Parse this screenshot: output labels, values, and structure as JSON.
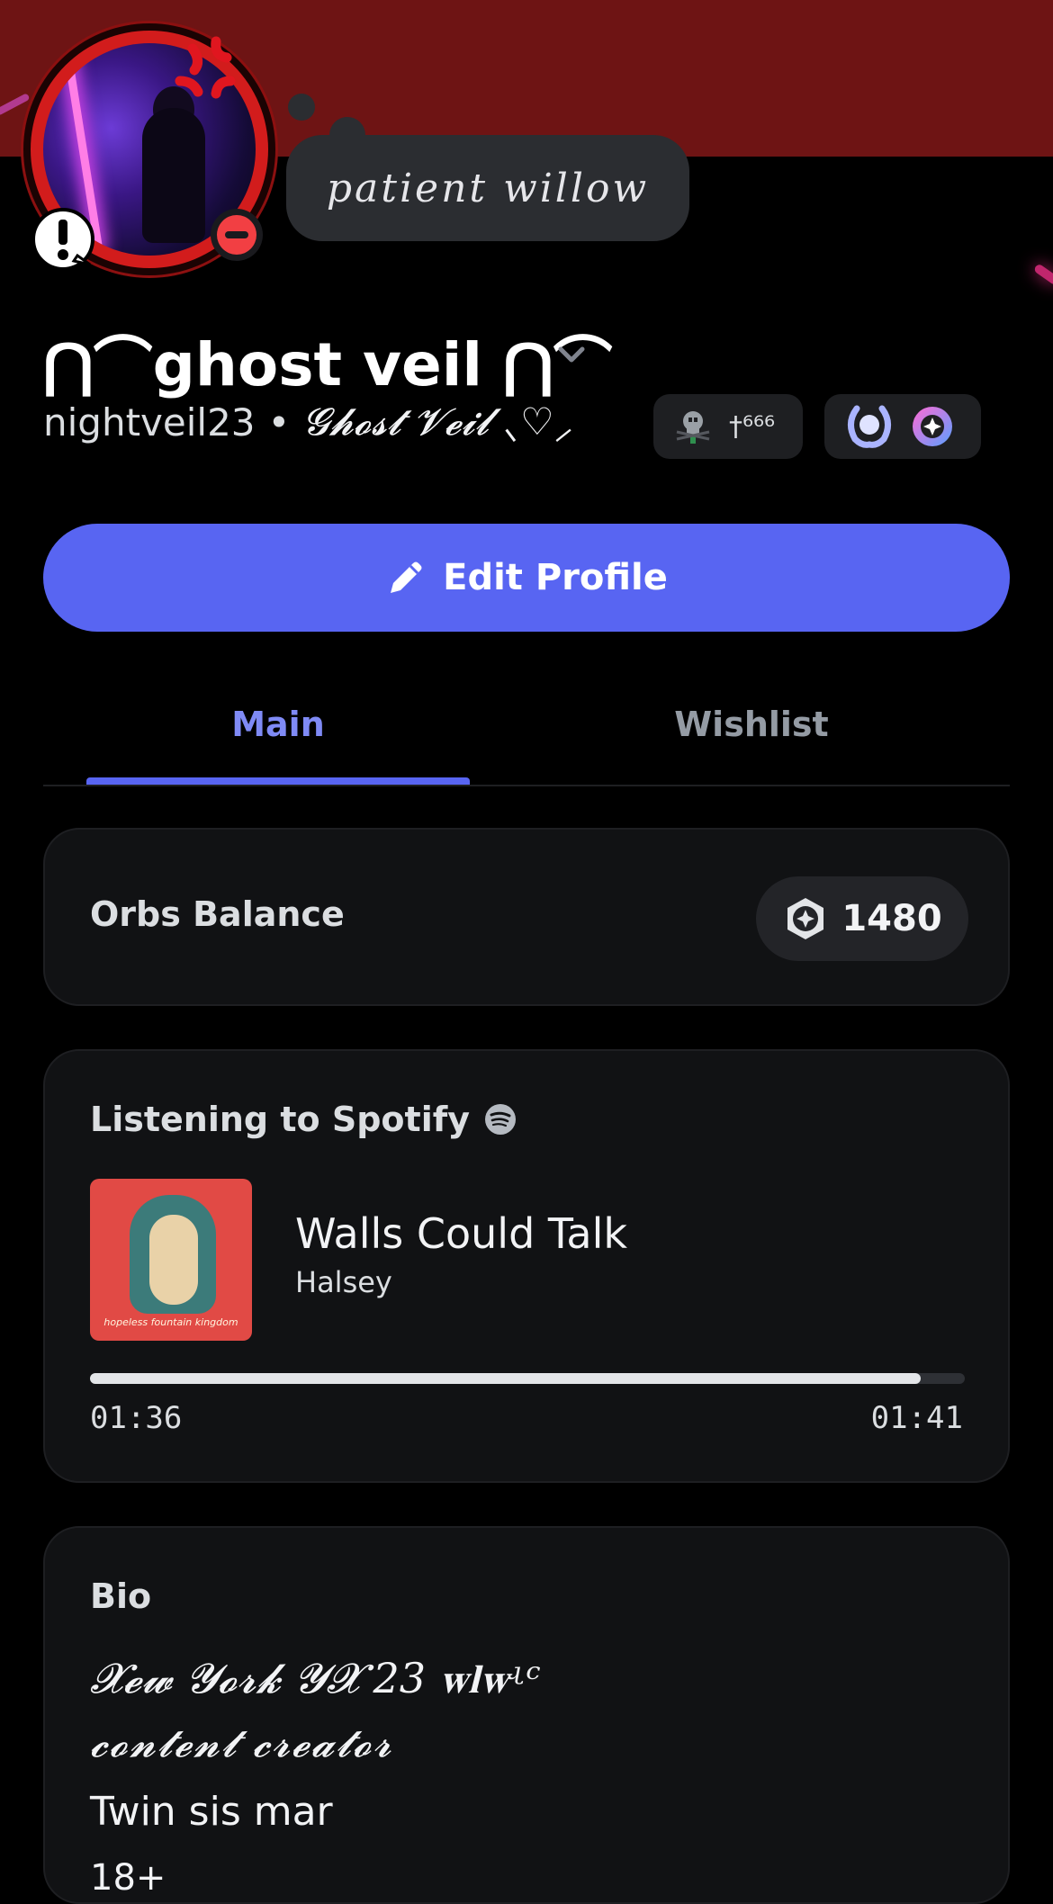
{
  "profile": {
    "status_text": "patient willow",
    "display_name": "⋂⌒ghost veil ⋂⌒",
    "username": "nightveil23",
    "separator": "•",
    "pronouns": "𝓖𝓱𝓸𝓼𝓽 𝓥𝓮𝓲𝓵 ⸜♡⸝",
    "badge_tag": "†⁶⁶⁶",
    "presence": "dnd"
  },
  "actions": {
    "edit_profile_label": "Edit Profile"
  },
  "tabs": [
    {
      "label": "Main",
      "active": true
    },
    {
      "label": "Wishlist",
      "active": false
    }
  ],
  "orbs": {
    "label": "Orbs Balance",
    "value": "1480"
  },
  "spotify": {
    "heading": "Listening to Spotify",
    "track": "Walls Could Talk",
    "artist": "Halsey",
    "album_caption": "hopeless fountain kingdom",
    "elapsed": "01:36",
    "total": "01:41",
    "progress": 0.95
  },
  "bio": {
    "title": "Bio",
    "lines": [
      "𝓧𝓮𝔀 𝓨𝓸𝓻𝓴 𝓨𝓧 23 𝐰𝐥𝐰ʵᶜ",
      "𝓬𝓸𝓷𝓽𝓮𝓷𝓽 𝓬𝓻𝓮𝓪𝓽𝓸𝓻",
      "Twin sis mar",
      "18+"
    ]
  },
  "colors": {
    "banner": "#6e1414",
    "accent": "#5865f2",
    "tab_active": "#7f8af5",
    "dnd": "#f23f43",
    "card_bg": "#111214"
  },
  "icons": [
    "anger-icon",
    "alert-icon",
    "dnd-status-icon",
    "chevron-down-icon",
    "skull-badge-icon",
    "laurel-badge-icon",
    "orb-badge-icon",
    "pencil-icon",
    "orb-icon",
    "spotify-icon"
  ]
}
